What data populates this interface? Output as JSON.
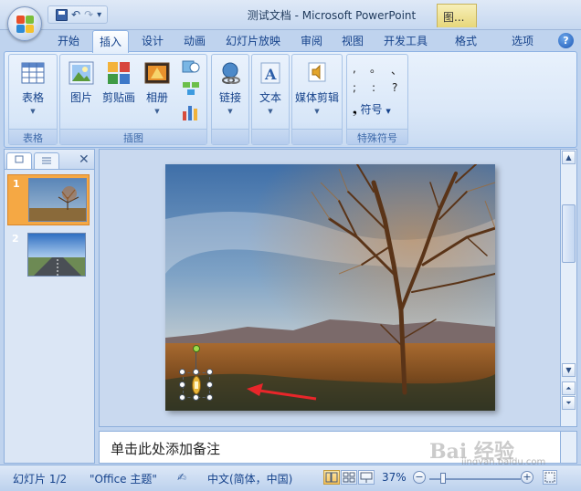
{
  "window": {
    "title": "测试文档 - Microsoft PowerPoint",
    "context_tab": "图..."
  },
  "qat": {
    "undo": "↶",
    "redo": "↷",
    "customize": "▾"
  },
  "tabs": [
    "开始",
    "插入",
    "设计",
    "动画",
    "幻灯片放映",
    "审阅",
    "视图",
    "开发工具",
    "格式",
    "选项"
  ],
  "active_tab": "插入",
  "ribbon": {
    "groups": {
      "table": {
        "label": "表格",
        "buttons": [
          "表格"
        ]
      },
      "illustrations": {
        "label": "插图",
        "buttons": [
          "图片",
          "剪贴画",
          "相册"
        ]
      },
      "links": {
        "buttons": [
          "链接"
        ]
      },
      "text": {
        "buttons": [
          "文本"
        ]
      },
      "media": {
        "buttons": [
          "媒体剪辑"
        ]
      },
      "special_symbols": {
        "label": "特殊符号",
        "symbols": [
          ",",
          "。",
          "、",
          ";",
          ":",
          "?"
        ],
        "symbol_button": "符号"
      }
    }
  },
  "left_pane": {
    "slides": [
      {
        "number": "1",
        "selected": true
      },
      {
        "number": "2",
        "selected": false
      }
    ]
  },
  "notes": {
    "placeholder": "单击此处添加备注"
  },
  "status": {
    "slide_info": "幻灯片 1/2",
    "theme": "\"Office 主题\"",
    "language": "中文(简体，中国)",
    "zoom": "37%"
  },
  "watermark": {
    "text": "Bai 经验",
    "url": "jingyan.baidu.com"
  },
  "colors": {
    "accent": "#15428b",
    "selected_slide": "#f5a844",
    "ribbon_bg": "#dbe8f8"
  }
}
